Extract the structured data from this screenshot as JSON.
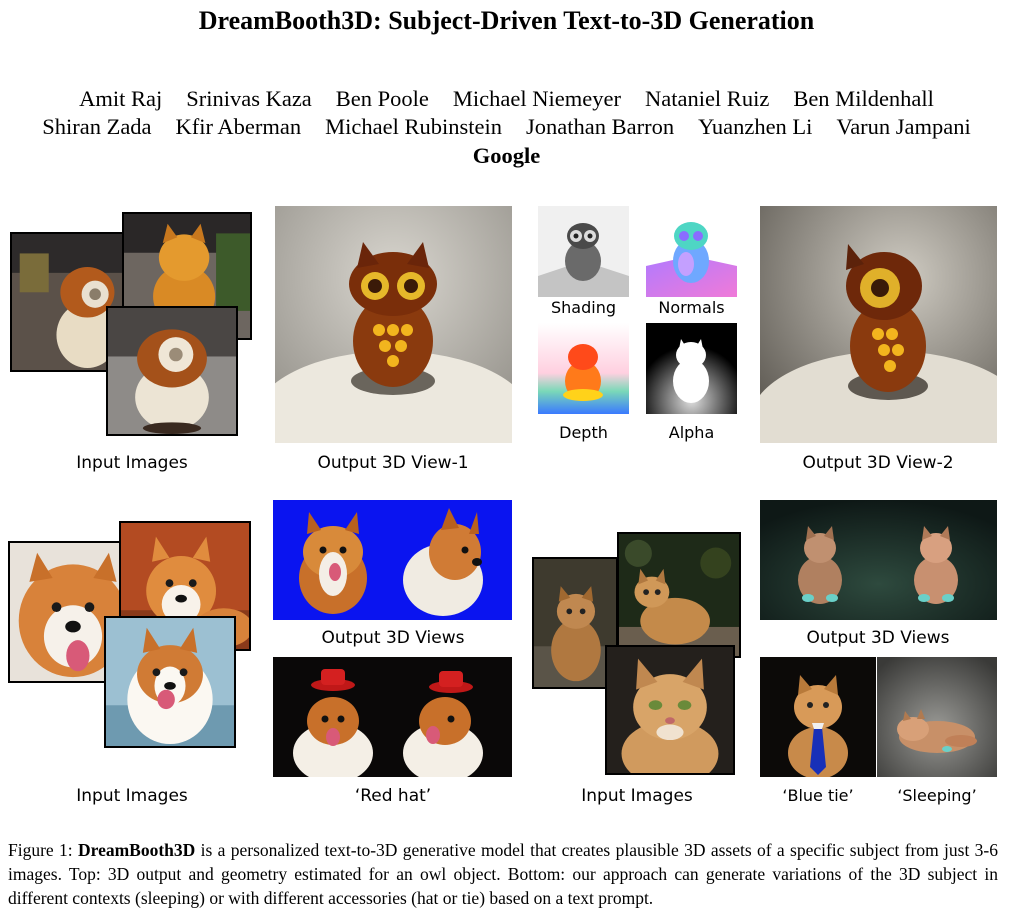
{
  "title": "DreamBooth3D: Subject-Driven Text-to-3D Generation",
  "authors_line1": [
    "Amit Raj",
    "Srinivas Kaza",
    "Ben Poole",
    "Michael Niemeyer",
    "Nataniel Ruiz",
    "Ben Mildenhall"
  ],
  "authors_line2": [
    "Shiran Zada",
    "Kfir Aberman",
    "Michael Rubinstein",
    "Jonathan Barron",
    "Yuanzhen Li",
    "Varun Jampani"
  ],
  "affiliation": "Google",
  "top_row": {
    "input_label": "Input Images",
    "view1_label": "Output 3D View-1",
    "shading_label": "Shading",
    "normals_label": "Normals",
    "depth_label": "Depth",
    "alpha_label": "Alpha",
    "view2_label": "Output 3D View-2"
  },
  "bottom_row": {
    "dog_input_label": "Input Images",
    "dog_output_label": "Output 3D Views",
    "dog_redhat_label": "‘Red hat’",
    "cat_input_label": "Input Images",
    "cat_output_label": "Output 3D Views",
    "cat_bluetie_label": "‘Blue tie’",
    "cat_sleeping_label": "‘Sleeping’"
  },
  "caption": {
    "prefix": "Figure 1: ",
    "bold": "DreamBooth3D",
    "text": " is a personalized text-to-3D generative model that creates plausible 3D assets of a specific subject from just 3-6 images. Top: 3D output and geometry estimated for an owl object. Bottom: our approach can generate variations of the 3D subject in different contexts (sleeping) or with different accessories (hat or tie) based on a text prompt."
  }
}
